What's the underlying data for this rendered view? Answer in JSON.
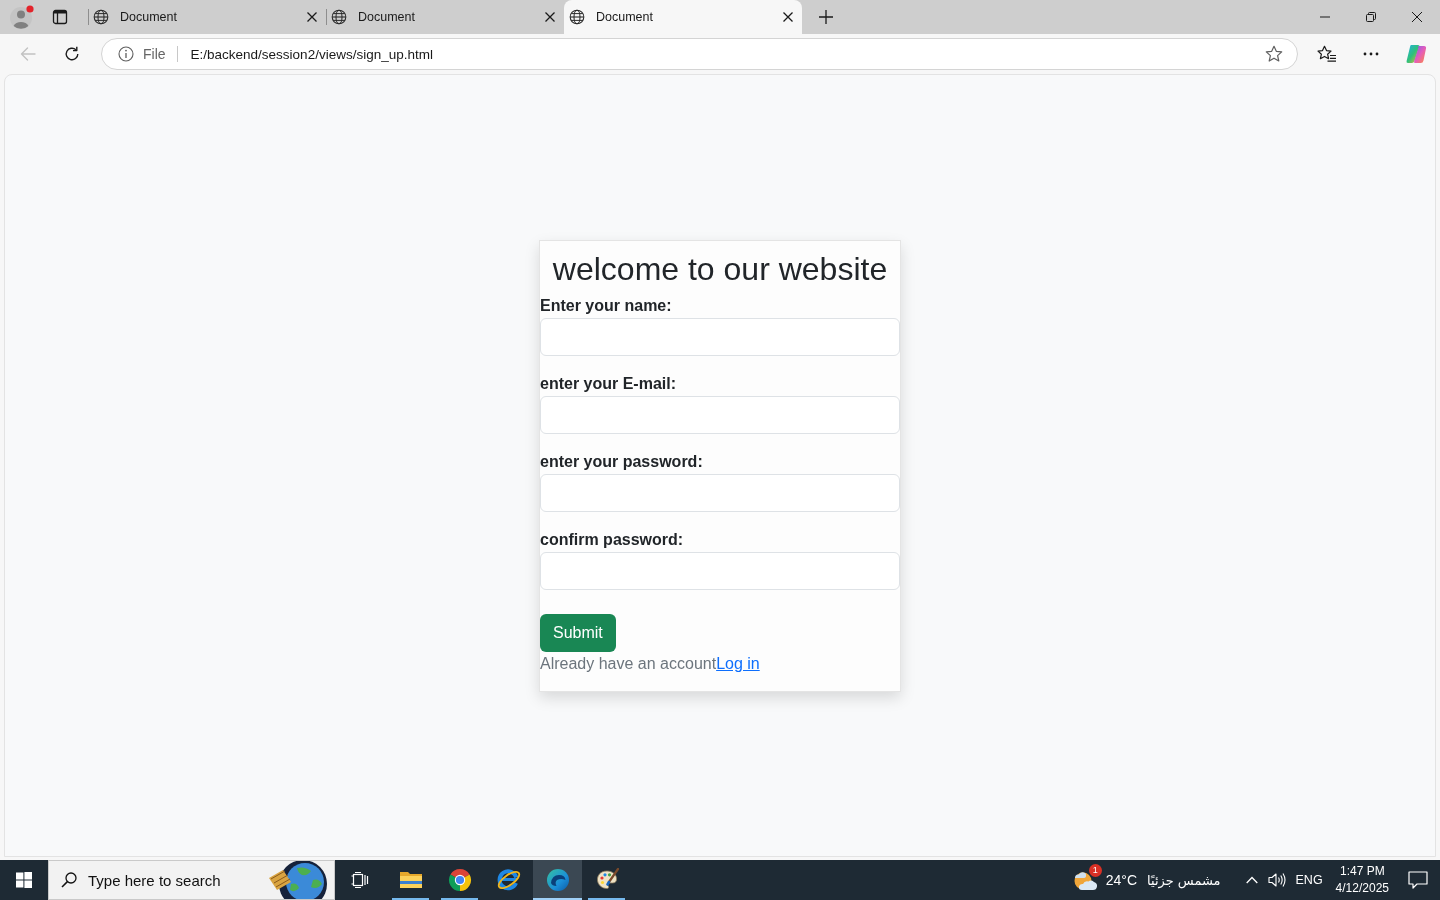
{
  "browser": {
    "tabs": [
      {
        "title": "Document",
        "selected": false
      },
      {
        "title": "Document",
        "selected": false
      },
      {
        "title": "Document",
        "selected": true
      }
    ],
    "back_button": {
      "disabled": true
    },
    "address_bar": {
      "scheme": "File",
      "url": "E:/backend/session2/views/sign_up.html"
    }
  },
  "page": {
    "heading": "welcome to our website",
    "fields": [
      {
        "label": "Enter your name:"
      },
      {
        "label": "enter your E-mail:"
      },
      {
        "label": "enter your password:"
      },
      {
        "label": "confirm password:"
      }
    ],
    "submit": "Submit",
    "login_prompt": {
      "text": "Already have an account",
      "link": "Log in"
    }
  },
  "taskbar": {
    "search": {
      "placeholder": "Type here to search"
    },
    "apps": [
      {
        "kind": "file-explorer",
        "running": true,
        "selected": false
      },
      {
        "kind": "chrome",
        "running": true,
        "selected": false
      },
      {
        "kind": "internet-explorer",
        "running": false,
        "selected": false
      },
      {
        "kind": "edge",
        "running": true,
        "selected": true
      },
      {
        "kind": "paint",
        "running": true,
        "selected": false
      }
    ],
    "weather": {
      "badge": "1",
      "temperature": "24°C",
      "condition": "مشمس جزئيًا"
    },
    "language": "ENG",
    "clock": {
      "time": "1:47 PM",
      "date": "4/12/2025"
    }
  }
}
